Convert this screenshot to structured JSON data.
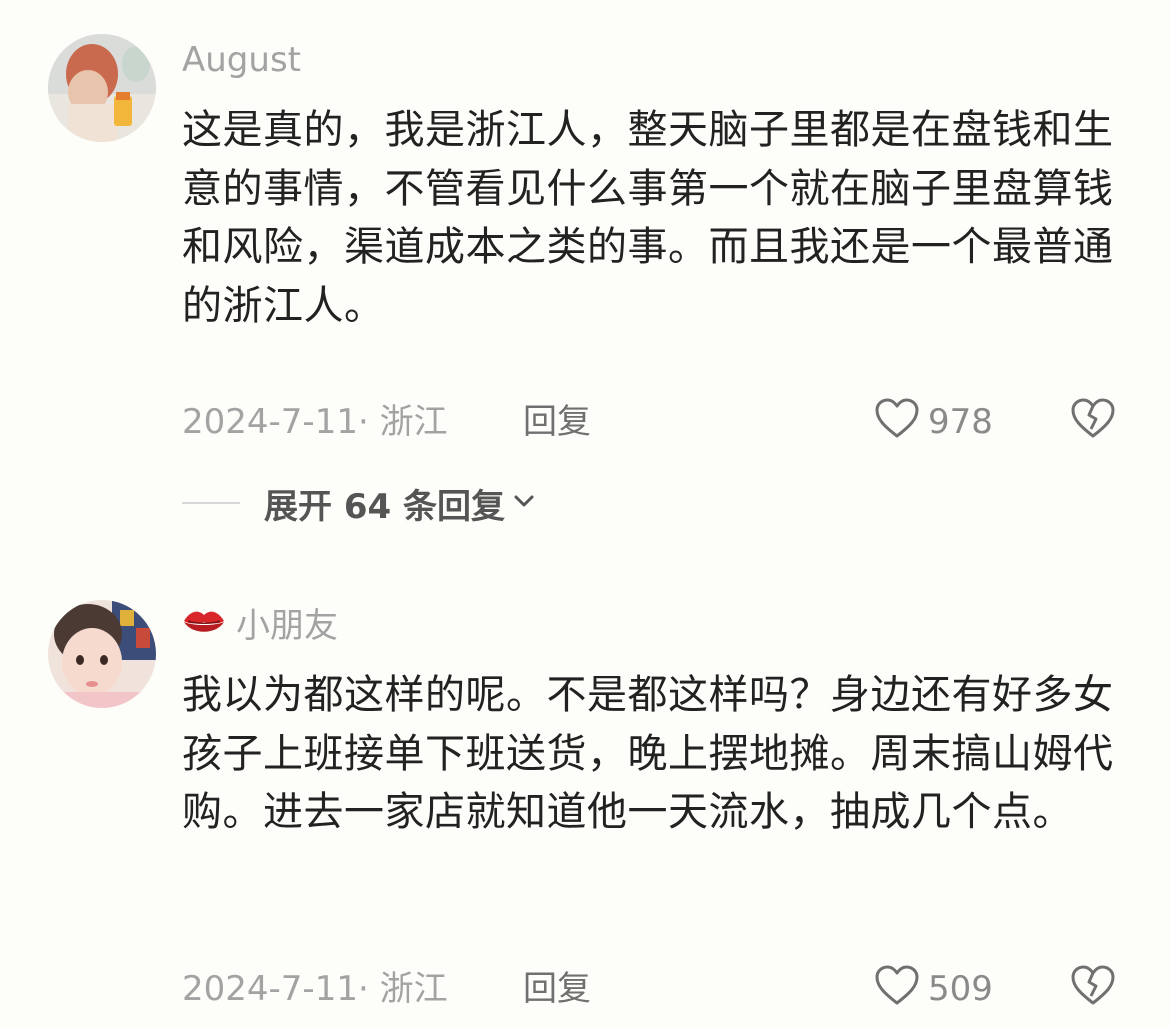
{
  "comments": [
    {
      "username": "August",
      "text": "这是真的，我是浙江人，整天脑子里都是在盘钱和生意的事情，不管看见什么事第一个就在脑子里盘算钱和风险，渠道成本之类的事。而且我还是一个最普通的浙江人。",
      "date_location": "2024-7-11· 浙江",
      "reply_label": "回复",
      "likes": "978",
      "expand_label": "展开 64 条回复"
    },
    {
      "username": "小朋友",
      "username_prefix_icon": "lips-emoji-icon",
      "text": "我以为都这样的呢。不是都这样吗？身边还有好多女孩子上班接单下班送货，晚上摆地摊。周末搞山姆代购。进去一家店就知道他一天流水，抽成几个点。",
      "date_location": "2024-7-11· 浙江",
      "reply_label": "回复",
      "likes": "509"
    }
  ],
  "colors": {
    "background": "#fdfdf9",
    "body_text": "#222222",
    "meta_text": "#a3a3a3",
    "icon": "#707070"
  }
}
